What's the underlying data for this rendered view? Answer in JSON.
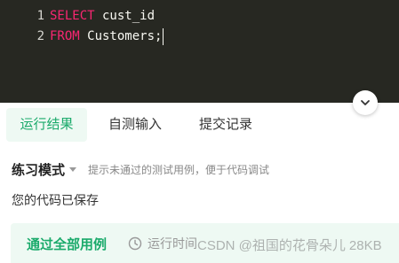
{
  "editor": {
    "lines": [
      {
        "number": "1",
        "keyword": "SELECT",
        "rest": " cust_id"
      },
      {
        "number": "2",
        "keyword": "FROM",
        "rest": " Customers;"
      }
    ],
    "collapse_icon": "chevron-down-icon"
  },
  "tabs": [
    {
      "label": "运行结果",
      "active": true
    },
    {
      "label": "自测输入",
      "active": false
    },
    {
      "label": "提交记录",
      "active": false
    }
  ],
  "mode": {
    "title": "练习模式",
    "hint": "提示未通过的测试用例，便于代码调试"
  },
  "status": {
    "saved": "您的代码已保存"
  },
  "result": {
    "pass_label": "通过全部用例",
    "time_label": "运行时间",
    "memory_value": "28KB"
  },
  "watermark": "CSDN @祖国的花骨朵儿",
  "colors": {
    "editor_bg": "#272822",
    "keyword": "#f92672",
    "accent_green": "#1aaa6b",
    "tab_active_bg": "#eef9f3"
  }
}
